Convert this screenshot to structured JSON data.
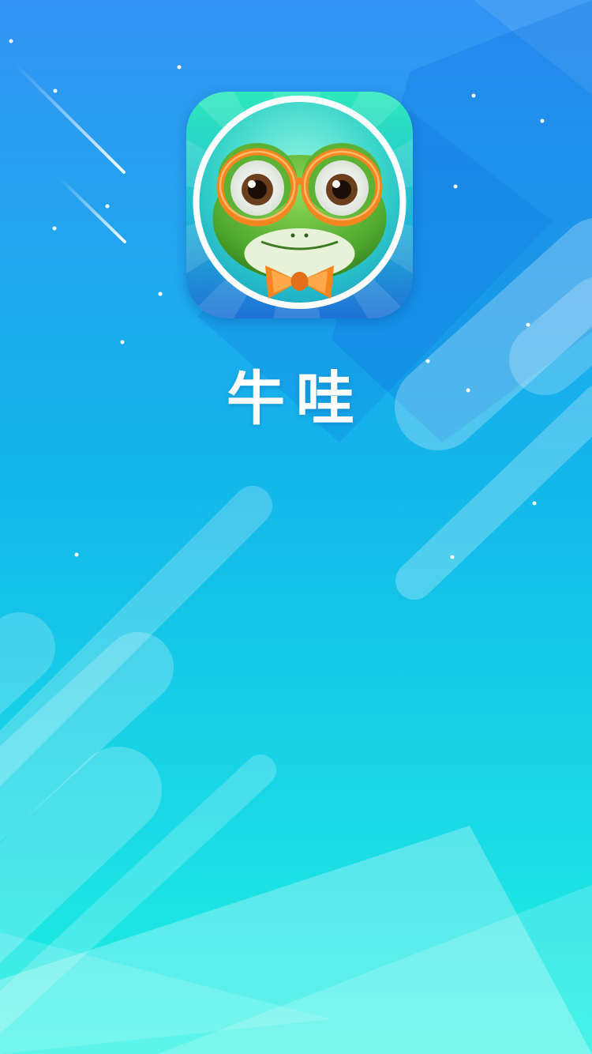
{
  "splash": {
    "app_name": "牛哇",
    "logo_icon": "frog-with-glasses-icon",
    "colors": {
      "gradient_top": "#2f8cf0",
      "gradient_mid": "#13b8ea",
      "gradient_bottom": "#1ff2e3",
      "icon_bg_green": "#2fe8b8",
      "icon_bg_blue": "#1e7fd8",
      "frog_green": "#5fb83a",
      "glasses_orange": "#f5861f",
      "text": "#ffffff"
    }
  }
}
